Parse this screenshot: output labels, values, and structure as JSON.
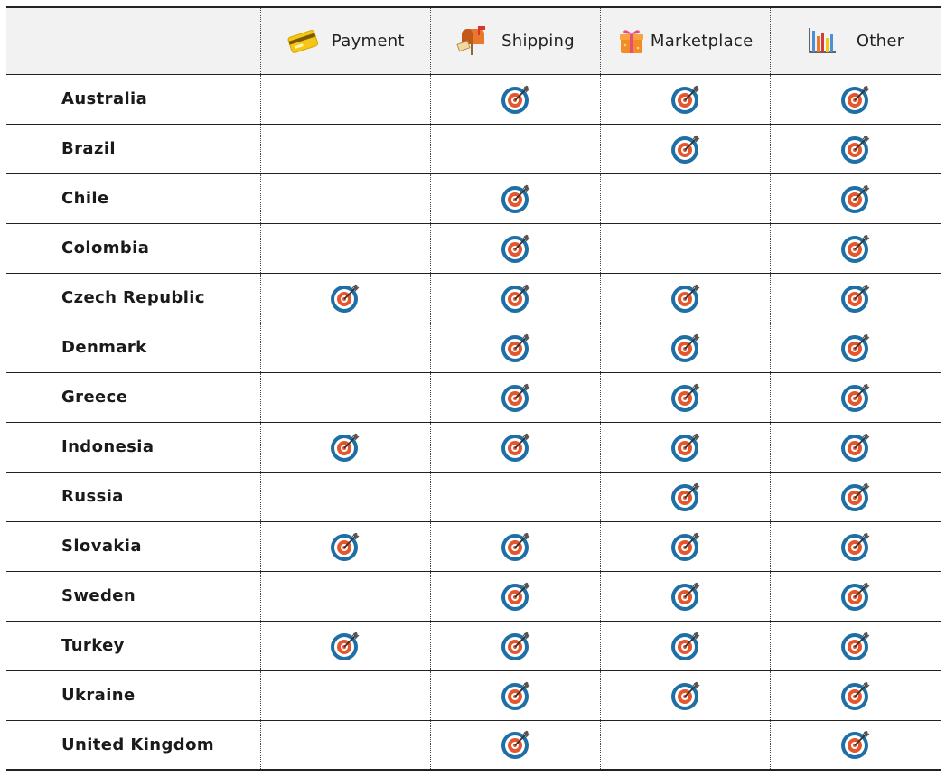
{
  "columns": [
    "Payment",
    "Shipping",
    "Marketplace",
    "Other"
  ],
  "column_icons": [
    "credit-card-icon",
    "mailbox-icon",
    "gift-box-icon",
    "bar-chart-icon"
  ],
  "rows": [
    {
      "country": "Australia",
      "marks": [
        false,
        true,
        true,
        true
      ]
    },
    {
      "country": "Brazil",
      "marks": [
        false,
        false,
        true,
        true
      ]
    },
    {
      "country": "Chile",
      "marks": [
        false,
        true,
        false,
        true
      ]
    },
    {
      "country": "Colombia",
      "marks": [
        false,
        true,
        false,
        true
      ]
    },
    {
      "country": "Czech Republic",
      "marks": [
        true,
        true,
        true,
        true
      ]
    },
    {
      "country": "Denmark",
      "marks": [
        false,
        true,
        true,
        true
      ]
    },
    {
      "country": "Greece",
      "marks": [
        false,
        true,
        true,
        true
      ]
    },
    {
      "country": "Indonesia",
      "marks": [
        true,
        true,
        true,
        true
      ]
    },
    {
      "country": "Russia",
      "marks": [
        false,
        false,
        true,
        true
      ]
    },
    {
      "country": "Slovakia",
      "marks": [
        true,
        true,
        true,
        true
      ]
    },
    {
      "country": "Sweden",
      "marks": [
        false,
        true,
        true,
        true
      ]
    },
    {
      "country": "Turkey",
      "marks": [
        true,
        true,
        true,
        true
      ]
    },
    {
      "country": "Ukraine",
      "marks": [
        false,
        true,
        true,
        true
      ]
    },
    {
      "country": "United Kingdom",
      "marks": [
        false,
        true,
        false,
        true
      ]
    }
  ],
  "mark_icon": "target-arrow-icon",
  "colors": {
    "target_outer": "#1d6fa5",
    "target_inner": "#e4572e",
    "header_bg": "#f2f2f2"
  }
}
